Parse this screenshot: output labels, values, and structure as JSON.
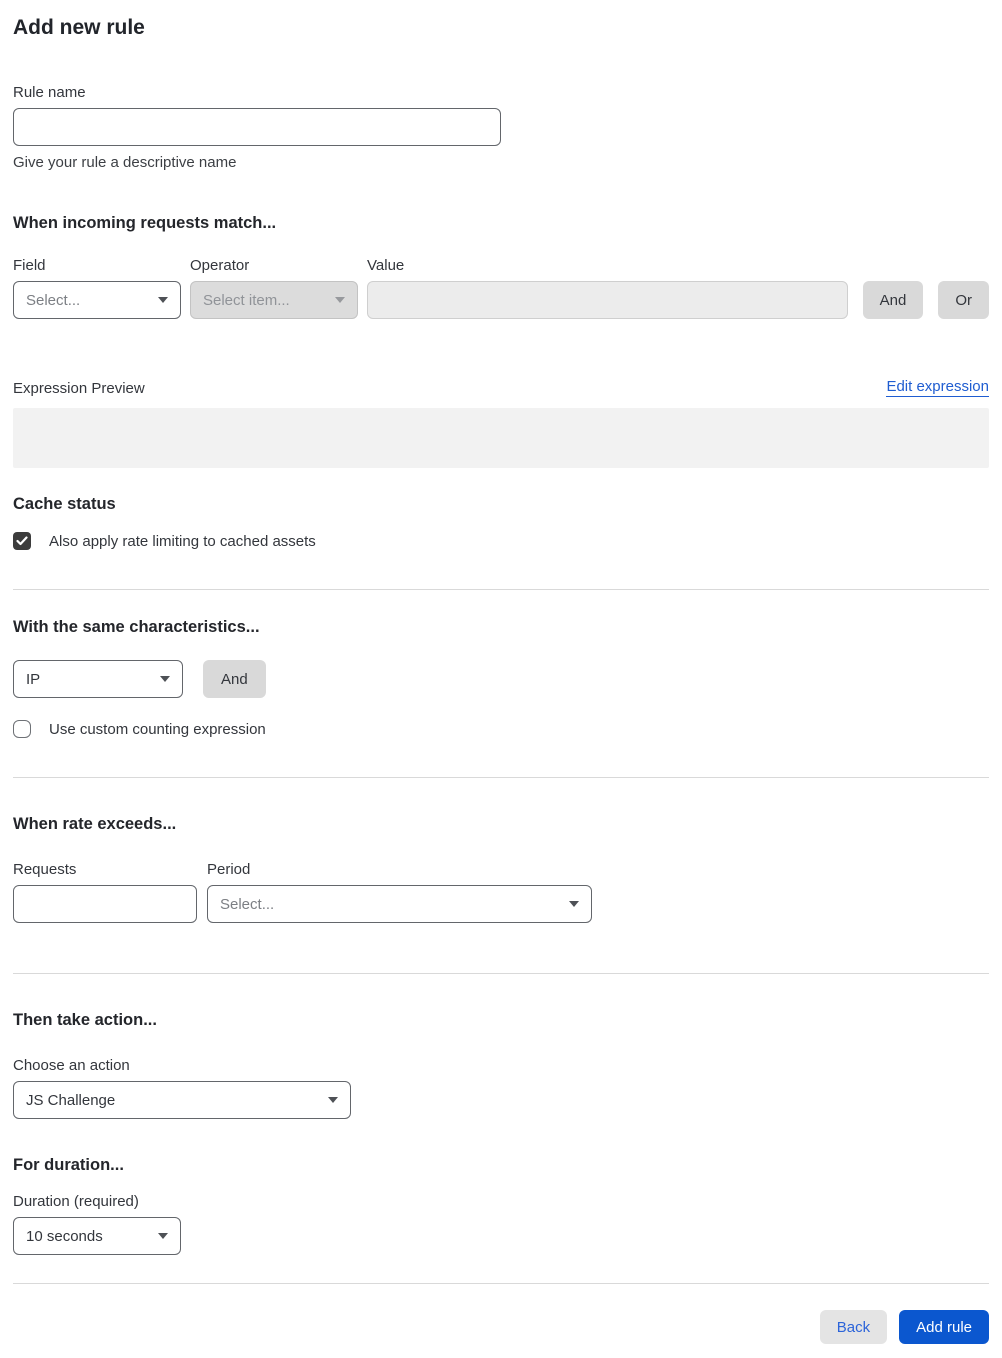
{
  "page": {
    "title": "Add new rule"
  },
  "rule_name": {
    "label": "Rule name",
    "value": "",
    "helper": "Give your rule a descriptive name"
  },
  "match_section": {
    "heading": "When incoming requests match...",
    "field": {
      "label": "Field",
      "selected": "Select..."
    },
    "operator": {
      "label": "Operator",
      "placeholder": "Select item...",
      "disabled": true
    },
    "value": {
      "label": "Value",
      "value": "",
      "disabled": true
    },
    "and_label": "And",
    "or_label": "Or"
  },
  "expression": {
    "label": "Expression Preview",
    "edit_link": "Edit expression",
    "preview_value": ""
  },
  "cache": {
    "heading": "Cache status",
    "checkbox_label": "Also apply rate limiting to cached assets",
    "checked": true
  },
  "characteristics": {
    "heading": "With the same characteristics...",
    "selected": "IP",
    "and_label": "And",
    "custom_expression_label": "Use custom counting expression",
    "custom_expression_checked": false
  },
  "rate": {
    "heading": "When rate exceeds...",
    "requests": {
      "label": "Requests",
      "value": ""
    },
    "period": {
      "label": "Period",
      "placeholder": "Select..."
    }
  },
  "action": {
    "heading": "Then take action...",
    "label": "Choose an action",
    "selected": "JS Challenge"
  },
  "duration": {
    "heading": "For duration...",
    "label": "Duration (required)",
    "selected": "10 seconds"
  },
  "footer": {
    "back_label": "Back",
    "submit_label": "Add rule"
  },
  "colors": {
    "primary_button": "#0b57cf",
    "link": "#1f5dd1",
    "disabled_control_bg": "#dcdcdc",
    "preview_box_bg": "#f2f2f2",
    "checked_checkbox": "#3c3c3c"
  }
}
